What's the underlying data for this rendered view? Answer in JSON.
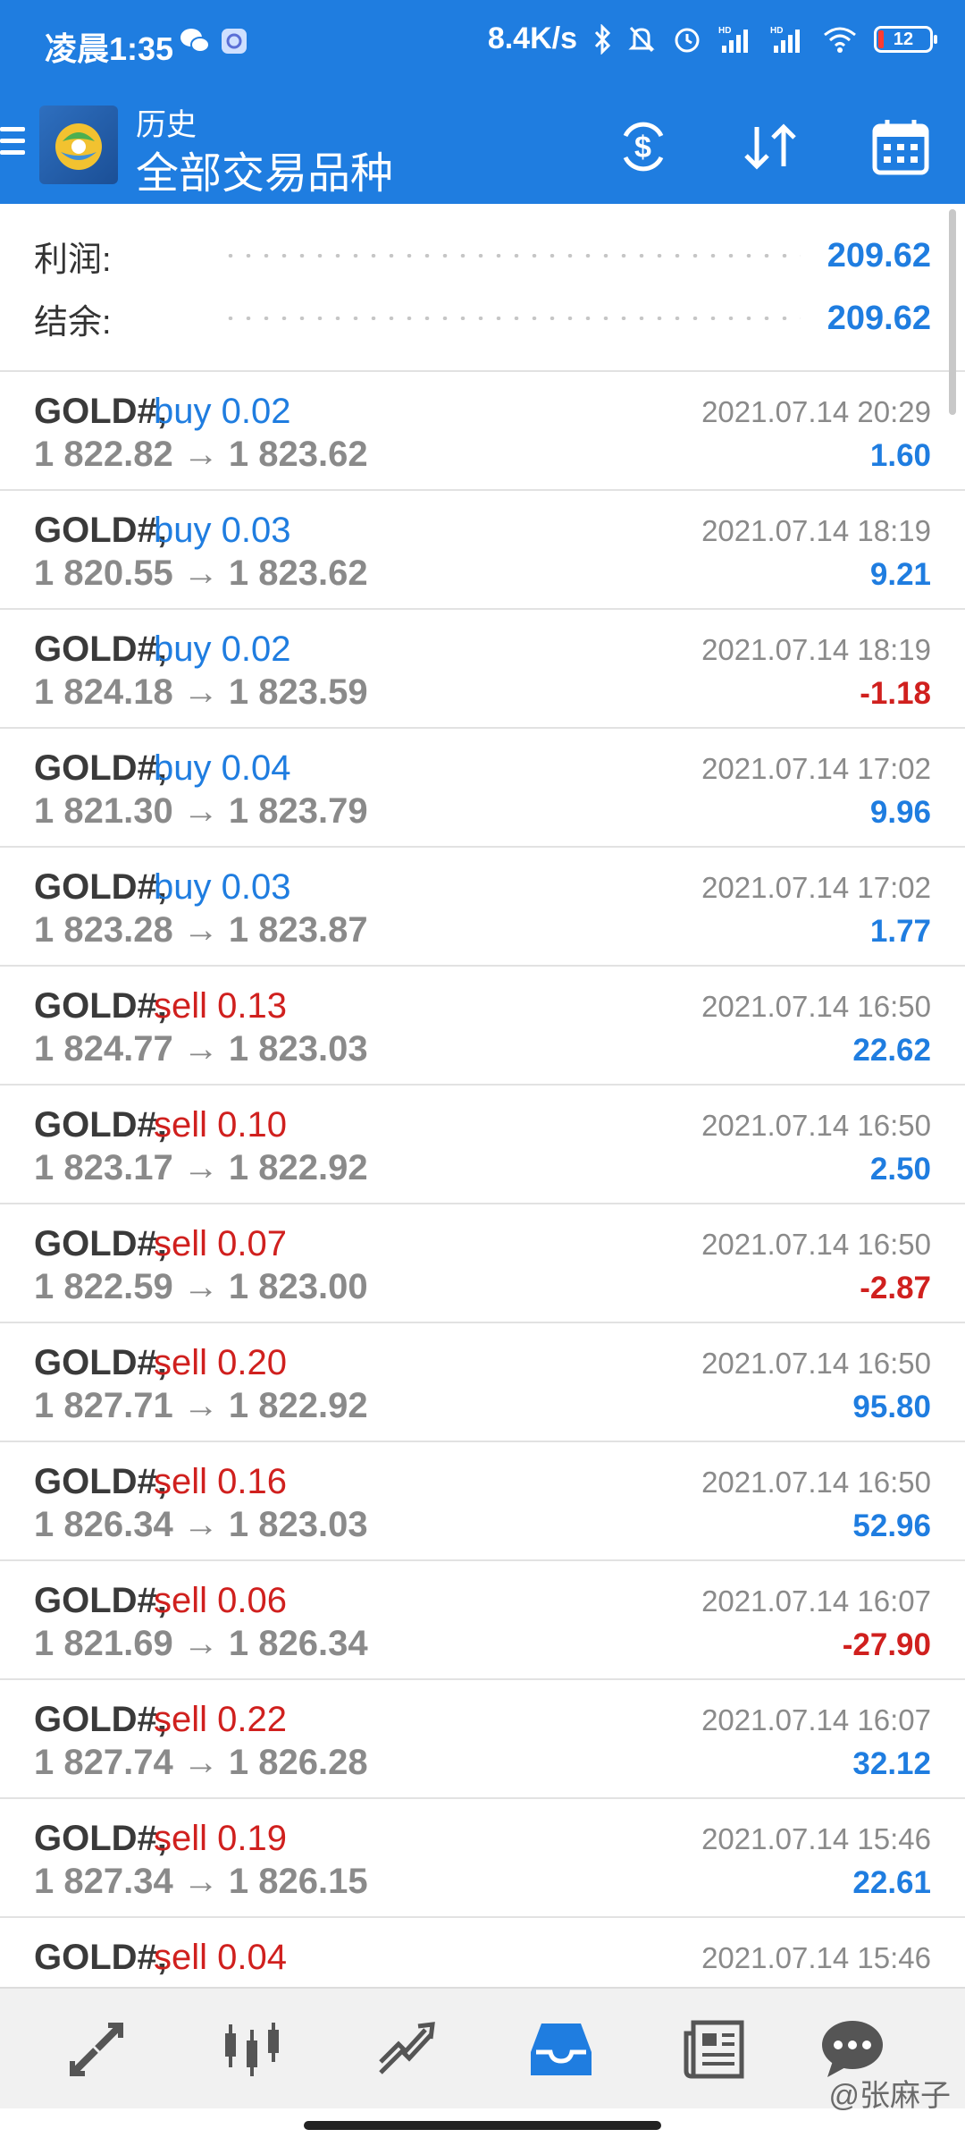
{
  "status_bar": {
    "time": "凌晨1:35",
    "net_speed": "8.4K/s",
    "battery": "12"
  },
  "app_bar": {
    "subtitle": "历史",
    "title": "全部交易品种"
  },
  "summary": {
    "profit_label": "利润:",
    "profit_value": "209.62",
    "balance_label": "结余:",
    "balance_value": "209.62"
  },
  "trades": [
    {
      "symbol": "GOLD#,",
      "side": "buy 0.02",
      "side_type": "buy",
      "prices": "1 822.82 → 1 823.62",
      "datetime": "2021.07.14 20:29",
      "profit": "1.60",
      "profit_sign": "pos"
    },
    {
      "symbol": "GOLD#,",
      "side": "buy 0.03",
      "side_type": "buy",
      "prices": "1 820.55 → 1 823.62",
      "datetime": "2021.07.14 18:19",
      "profit": "9.21",
      "profit_sign": "pos"
    },
    {
      "symbol": "GOLD#,",
      "side": "buy 0.02",
      "side_type": "buy",
      "prices": "1 824.18 → 1 823.59",
      "datetime": "2021.07.14 18:19",
      "profit": "-1.18",
      "profit_sign": "neg"
    },
    {
      "symbol": "GOLD#,",
      "side": "buy 0.04",
      "side_type": "buy",
      "prices": "1 821.30 → 1 823.79",
      "datetime": "2021.07.14 17:02",
      "profit": "9.96",
      "profit_sign": "pos"
    },
    {
      "symbol": "GOLD#,",
      "side": "buy 0.03",
      "side_type": "buy",
      "prices": "1 823.28 → 1 823.87",
      "datetime": "2021.07.14 17:02",
      "profit": "1.77",
      "profit_sign": "pos"
    },
    {
      "symbol": "GOLD#,",
      "side": "sell 0.13",
      "side_type": "sell",
      "prices": "1 824.77 → 1 823.03",
      "datetime": "2021.07.14 16:50",
      "profit": "22.62",
      "profit_sign": "pos"
    },
    {
      "symbol": "GOLD#,",
      "side": "sell 0.10",
      "side_type": "sell",
      "prices": "1 823.17 → 1 822.92",
      "datetime": "2021.07.14 16:50",
      "profit": "2.50",
      "profit_sign": "pos"
    },
    {
      "symbol": "GOLD#,",
      "side": "sell 0.07",
      "side_type": "sell",
      "prices": "1 822.59 → 1 823.00",
      "datetime": "2021.07.14 16:50",
      "profit": "-2.87",
      "profit_sign": "neg"
    },
    {
      "symbol": "GOLD#,",
      "side": "sell 0.20",
      "side_type": "sell",
      "prices": "1 827.71 → 1 822.92",
      "datetime": "2021.07.14 16:50",
      "profit": "95.80",
      "profit_sign": "pos"
    },
    {
      "symbol": "GOLD#,",
      "side": "sell 0.16",
      "side_type": "sell",
      "prices": "1 826.34 → 1 823.03",
      "datetime": "2021.07.14 16:50",
      "profit": "52.96",
      "profit_sign": "pos"
    },
    {
      "symbol": "GOLD#,",
      "side": "sell 0.06",
      "side_type": "sell",
      "prices": "1 821.69 → 1 826.34",
      "datetime": "2021.07.14 16:07",
      "profit": "-27.90",
      "profit_sign": "neg"
    },
    {
      "symbol": "GOLD#,",
      "side": "sell 0.22",
      "side_type": "sell",
      "prices": "1 827.74 → 1 826.28",
      "datetime": "2021.07.14 16:07",
      "profit": "32.12",
      "profit_sign": "pos"
    },
    {
      "symbol": "GOLD#,",
      "side": "sell 0.19",
      "side_type": "sell",
      "prices": "1 827.34 → 1 826.15",
      "datetime": "2021.07.14 15:46",
      "profit": "22.61",
      "profit_sign": "pos"
    },
    {
      "symbol": "GOLD#,",
      "side": "sell 0.04",
      "side_type": "sell",
      "prices": "",
      "datetime": "2021.07.14 15:46",
      "profit": "",
      "profit_sign": "pos"
    }
  ],
  "bottom_nav": {
    "items": [
      "quotes-icon",
      "chart-icon",
      "trade-icon",
      "history-icon",
      "news-icon",
      "chat-icon"
    ],
    "active": "history-icon"
  },
  "watermark": "@张麻子",
  "colors": {
    "primary": "#1f7de0",
    "sell": "#d0201e",
    "muted": "#8a8a8a"
  }
}
